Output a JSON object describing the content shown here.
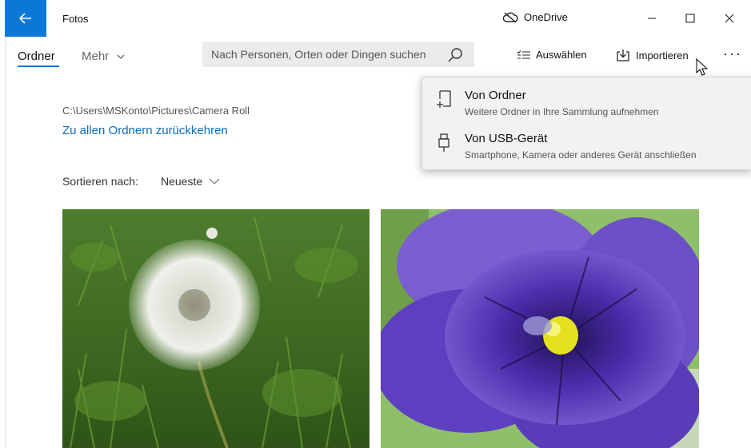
{
  "window": {
    "app_title": "Fotos",
    "onedrive_label": "OneDrive",
    "back_icon": "arrow-left-icon",
    "minimize_icon": "minimize-icon",
    "maximize_icon": "maximize-icon",
    "close_icon": "close-icon",
    "accent_color": "#0b78d7"
  },
  "toolbar": {
    "tabs": [
      {
        "label": "Ordner",
        "active": true
      },
      {
        "label": "Mehr",
        "dropdown": true
      }
    ],
    "search_placeholder": "Nach Personen, Orten oder Dingen suchen",
    "select_label": "Auswählen",
    "import_label": "Importieren",
    "more_icon": "more-icon"
  },
  "folder": {
    "path": "C:\\Users\\MSKonto\\Pictures\\Camera Roll",
    "back_link": "Zu allen Ordnern zurückkehren",
    "sort_label": "Sortieren nach:",
    "sort_value": "Neueste"
  },
  "photos": [
    {
      "subject": "dandelion-seedhead"
    },
    {
      "subject": "purple-pansy"
    }
  ],
  "import_menu": {
    "items": [
      {
        "title": "Von Ordner",
        "subtitle": "Weitere Ordner in Ihre Sammlung aufnehmen",
        "icon": "add-folder-icon"
      },
      {
        "title": "Von USB-Gerät",
        "subtitle": "Smartphone, Kamera oder anderes Gerät anschließen",
        "icon": "usb-icon"
      }
    ]
  }
}
